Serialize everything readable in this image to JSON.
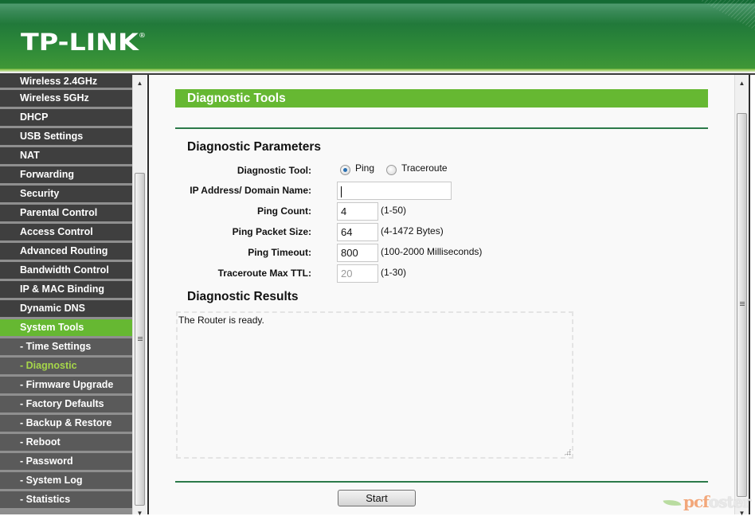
{
  "header": {
    "logo": "TP-LINK",
    "logo_mark": "®"
  },
  "sidebar": {
    "items": [
      {
        "label": "Wireless 2.4GHz",
        "type": "main"
      },
      {
        "label": "Wireless 5GHz",
        "type": "main"
      },
      {
        "label": "DHCP",
        "type": "main"
      },
      {
        "label": "USB Settings",
        "type": "main"
      },
      {
        "label": "NAT",
        "type": "main"
      },
      {
        "label": "Forwarding",
        "type": "main"
      },
      {
        "label": "Security",
        "type": "main"
      },
      {
        "label": "Parental Control",
        "type": "main"
      },
      {
        "label": "Access Control",
        "type": "main"
      },
      {
        "label": "Advanced Routing",
        "type": "main"
      },
      {
        "label": "Bandwidth Control",
        "type": "main"
      },
      {
        "label": "IP & MAC Binding",
        "type": "main"
      },
      {
        "label": "Dynamic DNS",
        "type": "main"
      },
      {
        "label": "System Tools",
        "type": "active"
      },
      {
        "label": "- Time Settings",
        "type": "sub"
      },
      {
        "label": "- Diagnostic",
        "type": "current"
      },
      {
        "label": "- Firmware Upgrade",
        "type": "sub"
      },
      {
        "label": "- Factory Defaults",
        "type": "sub"
      },
      {
        "label": "- Backup & Restore",
        "type": "sub"
      },
      {
        "label": "- Reboot",
        "type": "sub"
      },
      {
        "label": "- Password",
        "type": "sub"
      },
      {
        "label": "- System Log",
        "type": "sub"
      },
      {
        "label": "- Statistics",
        "type": "sub"
      }
    ]
  },
  "main": {
    "title": "Diagnostic Tools",
    "params_heading": "Diagnostic Parameters",
    "results_heading": "Diagnostic Results",
    "tool": {
      "label": "Diagnostic Tool:",
      "options": [
        "Ping",
        "Traceroute"
      ],
      "selected": "Ping"
    },
    "ip": {
      "label": "IP Address/ Domain Name:",
      "value": ""
    },
    "ping_count": {
      "label": "Ping Count:",
      "value": "4",
      "hint": "(1-50)"
    },
    "packet_size": {
      "label": "Ping Packet Size:",
      "value": "64",
      "hint": "(4-1472 Bytes)"
    },
    "timeout": {
      "label": "Ping Timeout:",
      "value": "800",
      "hint": "(100-2000 Milliseconds)"
    },
    "ttl": {
      "label": "Traceroute Max TTL:",
      "value": "20",
      "hint": "(1-30)"
    },
    "results_text": "The Router is ready.",
    "start_label": "Start"
  },
  "watermark": {
    "text_a": "pcf",
    "text_b": "oster"
  },
  "colors": {
    "brand_green": "#66b832",
    "header_green": "#21793a",
    "nav_dark": "#3f3f3f",
    "current_sub": "#a6d64a"
  }
}
